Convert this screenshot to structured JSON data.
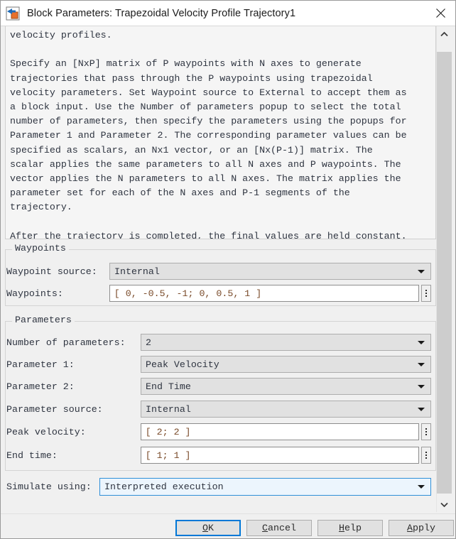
{
  "window": {
    "title": "Block Parameters: Trapezoidal Velocity Profile Trajectory1",
    "icon": "simulink-block-icon",
    "close_label": "✕"
  },
  "description": {
    "text": "velocity profiles.\n\nSpecify an [NxP] matrix of P waypoints with N axes to generate\ntrajectories that pass through the P waypoints using trapezoidal\nvelocity parameters. Set Waypoint source to External to accept them as\na block input. Use the Number of parameters popup to select the total\nnumber of parameters, then specify the parameters using the popups for\nParameter 1 and Parameter 2. The corresponding parameter values can be\nspecified as scalars, an Nx1 vector, or an [Nx(P-1)] matrix. The\nscalar applies the same parameters to all N axes and P waypoints. The\nvector applies the N parameters to all N axes. The matrix applies the\nparameter set for each of the N axes and P-1 segments of the\ntrajectory.\n\nAfter the trajectory is completed, the final values are held constant."
  },
  "scrollbar": {
    "up_glyph": "∧",
    "down_glyph": "∨"
  },
  "waypoints_group": {
    "title": "Waypoints",
    "waypoint_source": {
      "label": "Waypoint source:",
      "value": "Internal"
    },
    "waypoints": {
      "label": "Waypoints:",
      "value": "[ 0, -0.5, -1; 0, 0.5, 1 ]"
    }
  },
  "parameters_group": {
    "title": "Parameters",
    "number_of_parameters": {
      "label": "Number of parameters:",
      "value": "2"
    },
    "parameter_1": {
      "label": "Parameter 1:",
      "value": "Peak Velocity"
    },
    "parameter_2": {
      "label": "Parameter 2:",
      "value": "End Time"
    },
    "parameter_source": {
      "label": "Parameter source:",
      "value": "Internal"
    },
    "peak_velocity": {
      "label": "Peak velocity:",
      "value": "[ 2; 2 ]"
    },
    "end_time": {
      "label": "End time:",
      "value": "[ 1; 1 ]"
    }
  },
  "simulate": {
    "label": "Simulate using:",
    "value": "Interpreted execution"
  },
  "footer": {
    "ok": {
      "prefix": "",
      "mnemonic": "O",
      "suffix": "K"
    },
    "cancel": {
      "prefix": "",
      "mnemonic": "C",
      "suffix": "ancel"
    },
    "help": {
      "prefix": "",
      "mnemonic": "H",
      "suffix": "elp"
    },
    "apply": {
      "prefix": "",
      "mnemonic": "A",
      "suffix": "pply"
    }
  },
  "colors": {
    "accent": "#0078d7",
    "value_text": "#7a4b2a",
    "body_text": "#2e3440",
    "window_bg": "#f0f0f0"
  }
}
